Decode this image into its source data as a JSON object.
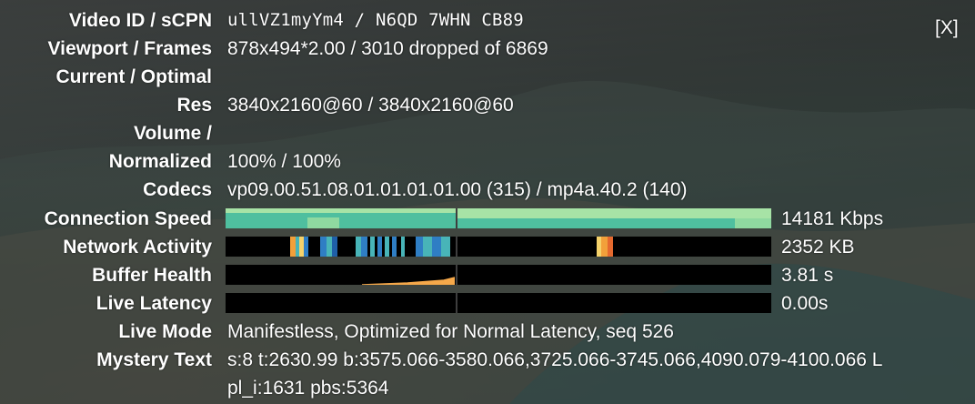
{
  "close_button": "[X]",
  "rows": {
    "video_id": {
      "label": "Video ID / sCPN",
      "value": "ullVZ1myYm4 / N6QD 7WHN CB89"
    },
    "viewport": {
      "label": "Viewport / Frames",
      "value": "878x494*2.00 / 3010 dropped of 6869"
    },
    "current_optimal": {
      "label": "Current / Optimal"
    },
    "res": {
      "label": "Res",
      "value": "3840x2160@60 / 3840x2160@60"
    },
    "volume": {
      "label": "Volume /"
    },
    "normalized": {
      "label": "Normalized",
      "value": "100% / 100%"
    },
    "codecs": {
      "label": "Codecs",
      "value": "vp09.00.51.08.01.01.01.01.00 (315) / mp4a.40.2 (140)"
    },
    "connection_speed": {
      "label": "Connection Speed",
      "value": "14181 Kbps"
    },
    "network_activity": {
      "label": "Network Activity",
      "value": "2352 KB"
    },
    "buffer_health": {
      "label": "Buffer Health",
      "value": "3.81 s"
    },
    "live_latency": {
      "label": "Live Latency",
      "value": "0.00s"
    },
    "live_mode": {
      "label": "Live Mode",
      "value": "Manifestless, Optimized for Normal Latency, seq 526"
    },
    "mystery_text": {
      "label": "Mystery Text",
      "value_line1": "s:8 t:2630.99 b:3575.066-3580.066,3725.066-3745.066,4090.079-4100.066 L",
      "value_line2": "pl_i:1631 pbs:5364"
    }
  },
  "colors": {
    "speed_light": "#8fd9a0",
    "speed_dark": "#4fbf9f",
    "speed_pale": "#a7e3a6",
    "net_orange": "#f2a03a",
    "net_blue": "#2f7ec4",
    "net_teal": "#48b4b8",
    "net_yellow": "#f5d26a",
    "buffer_orange": "#f5a84a",
    "graph_bg": "#000000"
  }
}
